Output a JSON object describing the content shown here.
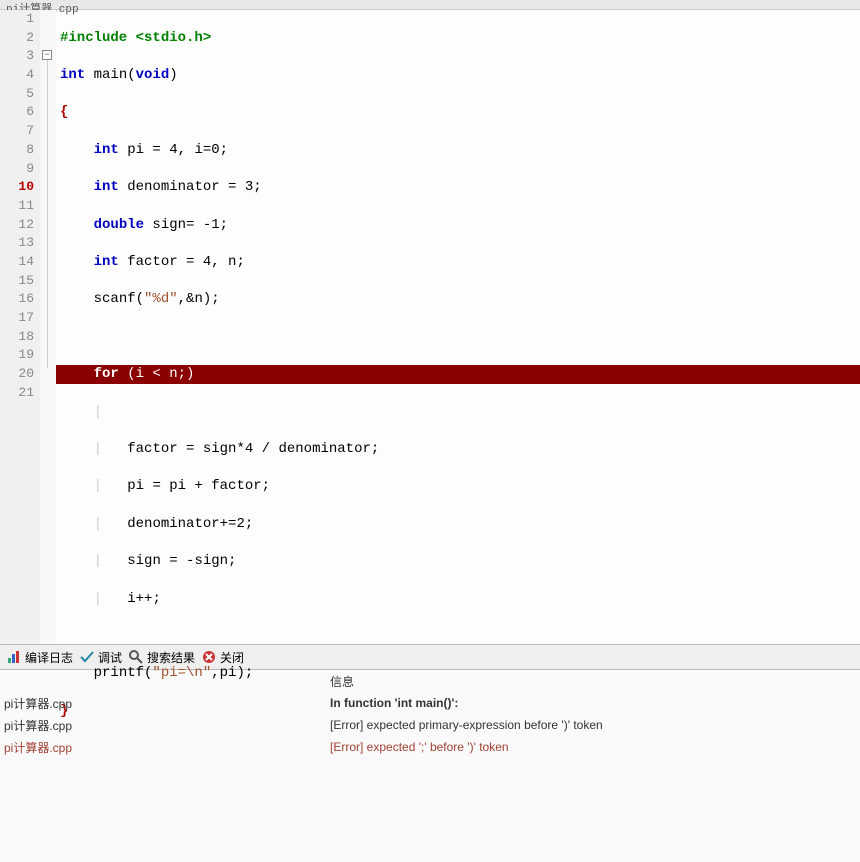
{
  "tab": {
    "title": "pi计算器.cpp"
  },
  "lines": [
    "1",
    "2",
    "3",
    "4",
    "5",
    "6",
    "7",
    "8",
    "9",
    "10",
    "11",
    "12",
    "13",
    "14",
    "15",
    "16",
    "17",
    "18",
    "19",
    "20",
    "21"
  ],
  "errorGutterLine": "10",
  "code": {
    "l1_include": "#include",
    "l1_header": "<stdio.h>",
    "l2_int": "int",
    "l2_main": " main",
    "l2_void": "void",
    "l3_brace": "{",
    "l4_int": "int",
    "l4_rest": " pi = 4, i=0;",
    "l5_int": "int",
    "l5_rest": " denominator = 3;",
    "l6_double": "double",
    "l6_rest": " sign= -1;",
    "l7_int": "int",
    "l7_rest": " factor = 4, n;",
    "l8_scanf": "scanf(",
    "l8_fmt": "\"%d\"",
    "l8_rest": ",&n);",
    "l10_for": "for",
    "l10_rest": " (i < n;)",
    "l12": "factor = sign*4 / denominator;",
    "l13": "pi = pi + factor;",
    "l14": "denominator+=2;",
    "l15": "sign = -sign;",
    "l16": "i++;",
    "l18_printf": "printf(",
    "l18_fmt": "\"pi=\\n\"",
    "l18_rest": ",pi);",
    "l19_brace": "}"
  },
  "toolbar": {
    "compileLog": "编译日志",
    "debug": "调试",
    "searchResults": "搜索结果",
    "close": "关闭"
  },
  "errorsHeader": "信息",
  "errorRows": [
    {
      "file": "pi计算器.cpp",
      "msg": "In function 'int main()':",
      "red": false
    },
    {
      "file": "pi计算器.cpp",
      "msg": "[Error] expected primary-expression before ')' token",
      "red": false
    },
    {
      "file": "pi计算器.cpp",
      "msg": "[Error] expected ';' before ')' token",
      "red": true
    }
  ]
}
